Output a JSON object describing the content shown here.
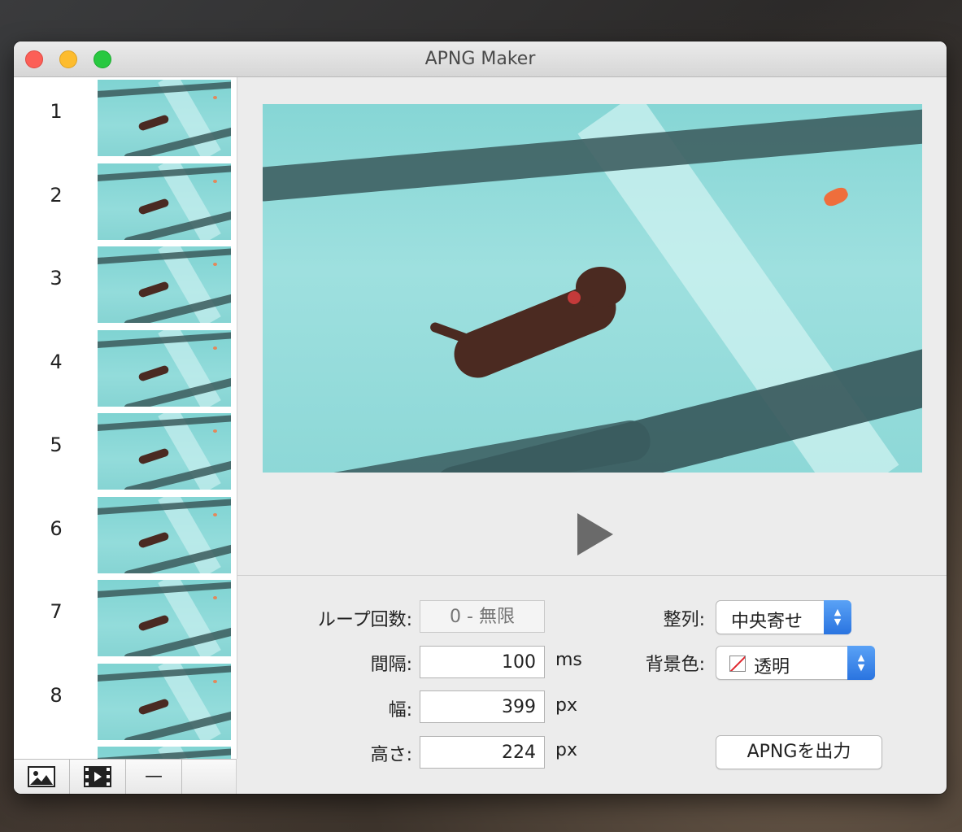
{
  "window": {
    "title": "APNG Maker"
  },
  "frames": [
    {
      "number": "1"
    },
    {
      "number": "2"
    },
    {
      "number": "3"
    },
    {
      "number": "4"
    },
    {
      "number": "5"
    },
    {
      "number": "6"
    },
    {
      "number": "7"
    },
    {
      "number": "8"
    }
  ],
  "sidebar_toolbar": {
    "buttons": [
      {
        "icon": "image-icon"
      },
      {
        "icon": "film-icon"
      },
      {
        "icon": "minus-icon",
        "label": "—"
      },
      {
        "icon": ""
      }
    ]
  },
  "settings": {
    "loop": {
      "label": "ループ回数:",
      "placeholder": "0 - 無限"
    },
    "interval": {
      "label": "間隔:",
      "value": "100",
      "unit": "ms"
    },
    "width": {
      "label": "幅:",
      "value": "399",
      "unit": "px"
    },
    "height": {
      "label": "高さ:",
      "value": "224",
      "unit": "px"
    },
    "align": {
      "label": "整列:",
      "value": "中央寄せ"
    },
    "background": {
      "label": "背景色:",
      "value": "透明"
    },
    "export_button": "APNGを出力"
  },
  "colors": {
    "accent": "#2a74e0",
    "close": "#fc5f57",
    "minimize": "#fdbc2e",
    "zoom": "#28c840"
  }
}
